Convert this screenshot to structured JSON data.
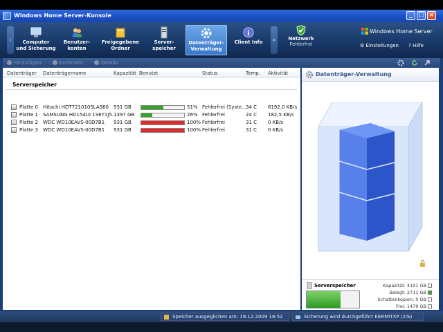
{
  "window": {
    "title": "Windows Home Server-Konsole"
  },
  "nav": {
    "tabs": [
      {
        "line1": "Computer",
        "line2": "und Sicherung"
      },
      {
        "line1": "Benutzer-",
        "line2": "konten"
      },
      {
        "line1": "Freigegebene",
        "line2": "Ordner"
      },
      {
        "line1": "Server-",
        "line2": "speicher"
      },
      {
        "line1": "Datenträger-",
        "line2": "Verwaltung"
      },
      {
        "line1": "Client Info",
        "line2": ""
      }
    ],
    "network": {
      "label": "Netzwerk",
      "status": "Fehlerfrei"
    },
    "brand": "Windows Home Server",
    "settings": "Einstellungen",
    "help": "Hilfe"
  },
  "toolbar": {
    "add": "Hinzufügen",
    "remove": "Entfernen",
    "details": "Details"
  },
  "table": {
    "headers": [
      "Datenträger",
      "Datenträgername",
      "Kapazität",
      "Benutzt",
      "Status",
      "Temp.",
      "Aktivität"
    ],
    "group": "Serverspeicher",
    "rows": [
      {
        "disk": "Platte 0",
        "name": "Hitachi HDT721010SLA360",
        "capacity": "931 GB",
        "used_pct": 51,
        "used": "51%",
        "status": "Fehlerfrei (Syste...",
        "temp": "34 C",
        "activity": "8192,0 KB/s"
      },
      {
        "disk": "Platte 1",
        "name": "SAMSUNG HD154UI 1S6Y1J5...",
        "capacity": "1397 GB",
        "used_pct": 26,
        "used": "26%",
        "status": "Fehlerfrei",
        "temp": "24 C",
        "activity": "182,5 KB/s"
      },
      {
        "disk": "Platte 2",
        "name": "WDC WD10EAVS-00D7B1",
        "capacity": "931 GB",
        "used_pct": 100,
        "used": "100%",
        "status": "Fehlerfrei",
        "temp": "31 C",
        "activity": "0 KB/s"
      },
      {
        "disk": "Platte 3",
        "name": "WDC WD10EAVS-00D7B1",
        "capacity": "931 GB",
        "used_pct": 100,
        "used": "100%",
        "status": "Fehlerfrei",
        "temp": "31 C",
        "activity": "0 KB/s"
      }
    ]
  },
  "side": {
    "title": "Datenträger-Verwaltung",
    "storage_title": "Serverspeicher",
    "storage_fill": 0.647,
    "stats": [
      {
        "label": "Kapazität:",
        "value": "4191 GB"
      },
      {
        "label": "Belegt:",
        "value": "2711 GB"
      },
      {
        "label": "Schattenkopien:",
        "value": "0 GB"
      },
      {
        "label": "Frei:",
        "value": "1479 GB"
      }
    ]
  },
  "statusbar": {
    "balance": "Speicher ausgeglichen am: 19.12.2009 16:52",
    "backup": "Sicherung wird durchgeführt KERMITXP (2%)"
  },
  "colors": {
    "green_bar": "#35a42a",
    "red_bar": "#e02a2a",
    "active_tab": "#3b78c8"
  }
}
